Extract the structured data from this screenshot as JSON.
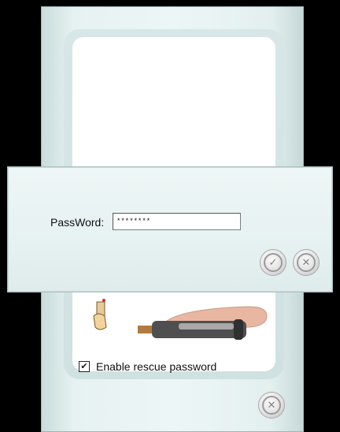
{
  "password_dialog": {
    "label": "PassWord:",
    "value": "********",
    "ok_icon": "check-icon",
    "cancel_icon": "x-icon"
  },
  "main_dialog": {
    "rescue_checkbox_label": "Enable rescue password",
    "rescue_checked": true,
    "close_icon": "x-icon"
  },
  "colors": {
    "panel_bg": "#e6f1f1",
    "panel_border": "#9fb5b5",
    "background": "#000000"
  }
}
